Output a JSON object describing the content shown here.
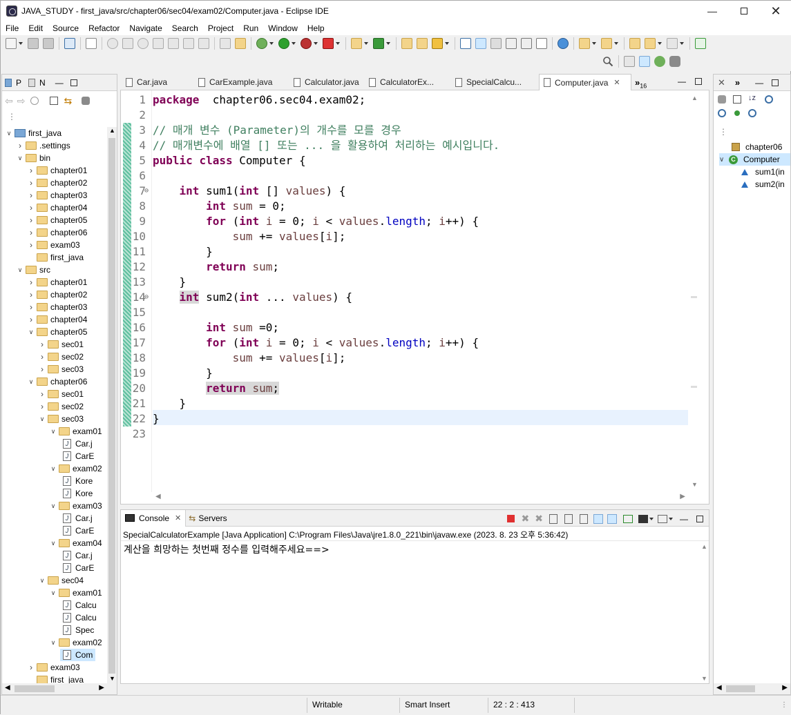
{
  "window": {
    "title": "JAVA_STUDY - first_java/src/chapter06/sec04/exam02/Computer.java - Eclipse IDE"
  },
  "menu": [
    "File",
    "Edit",
    "Source",
    "Refactor",
    "Navigate",
    "Search",
    "Project",
    "Run",
    "Window",
    "Help"
  ],
  "left_panel": {
    "tabs": [
      {
        "label": "P"
      },
      {
        "label": "N"
      }
    ],
    "tree": [
      {
        "label": "first_java",
        "depth": 0,
        "type": "project",
        "open": true
      },
      {
        "label": ".settings",
        "depth": 1,
        "type": "folder",
        "open": false
      },
      {
        "label": "bin",
        "depth": 1,
        "type": "folder",
        "open": true
      },
      {
        "label": "chapter01",
        "depth": 2,
        "type": "folder",
        "open": false
      },
      {
        "label": "chapter02",
        "depth": 2,
        "type": "folder",
        "open": false
      },
      {
        "label": "chapter03",
        "depth": 2,
        "type": "folder",
        "open": false
      },
      {
        "label": "chapter04",
        "depth": 2,
        "type": "folder",
        "open": false
      },
      {
        "label": "chapter05",
        "depth": 2,
        "type": "folder",
        "open": false
      },
      {
        "label": "chapter06",
        "depth": 2,
        "type": "folder",
        "open": false
      },
      {
        "label": "exam03",
        "depth": 2,
        "type": "folder",
        "open": false
      },
      {
        "label": "first_java",
        "depth": 2,
        "type": "folder",
        "leaf": true
      },
      {
        "label": "src",
        "depth": 1,
        "type": "folder",
        "open": true
      },
      {
        "label": "chapter01",
        "depth": 2,
        "type": "folder",
        "open": false
      },
      {
        "label": "chapter02",
        "depth": 2,
        "type": "folder",
        "open": false
      },
      {
        "label": "chapter03",
        "depth": 2,
        "type": "folder",
        "open": false
      },
      {
        "label": "chapter04",
        "depth": 2,
        "type": "folder",
        "open": false
      },
      {
        "label": "chapter05",
        "depth": 2,
        "type": "folder",
        "open": true
      },
      {
        "label": "sec01",
        "depth": 3,
        "type": "folder",
        "open": false
      },
      {
        "label": "sec02",
        "depth": 3,
        "type": "folder",
        "open": false
      },
      {
        "label": "sec03",
        "depth": 3,
        "type": "folder",
        "open": false
      },
      {
        "label": "chapter06",
        "depth": 2,
        "type": "folder",
        "open": true
      },
      {
        "label": "sec01",
        "depth": 3,
        "type": "folder",
        "open": false
      },
      {
        "label": "sec02",
        "depth": 3,
        "type": "folder",
        "open": false
      },
      {
        "label": "sec03",
        "depth": 3,
        "type": "folder",
        "open": true
      },
      {
        "label": "exam01",
        "depth": 4,
        "type": "folder",
        "open": true
      },
      {
        "label": "Car.j",
        "depth": 5,
        "type": "file"
      },
      {
        "label": "CarE",
        "depth": 5,
        "type": "file"
      },
      {
        "label": "exam02",
        "depth": 4,
        "type": "folder",
        "open": true
      },
      {
        "label": "Kore",
        "depth": 5,
        "type": "file"
      },
      {
        "label": "Kore",
        "depth": 5,
        "type": "file"
      },
      {
        "label": "exam03",
        "depth": 4,
        "type": "folder",
        "open": true
      },
      {
        "label": "Car.j",
        "depth": 5,
        "type": "file"
      },
      {
        "label": "CarE",
        "depth": 5,
        "type": "file"
      },
      {
        "label": "exam04",
        "depth": 4,
        "type": "folder",
        "open": true
      },
      {
        "label": "Car.j",
        "depth": 5,
        "type": "file"
      },
      {
        "label": "CarE",
        "depth": 5,
        "type": "file"
      },
      {
        "label": "sec04",
        "depth": 3,
        "type": "folder",
        "open": true
      },
      {
        "label": "exam01",
        "depth": 4,
        "type": "folder",
        "open": true
      },
      {
        "label": "Calcu",
        "depth": 5,
        "type": "file"
      },
      {
        "label": "Calcu",
        "depth": 5,
        "type": "file"
      },
      {
        "label": "Spec",
        "depth": 5,
        "type": "file"
      },
      {
        "label": "exam02",
        "depth": 4,
        "type": "folder",
        "open": true
      },
      {
        "label": "Com",
        "depth": 5,
        "type": "file",
        "selected": true
      },
      {
        "label": "exam03",
        "depth": 2,
        "type": "folder",
        "open": false
      },
      {
        "label": "first_java",
        "depth": 2,
        "type": "folder",
        "leaf": true
      }
    ]
  },
  "editor": {
    "tabs": [
      {
        "label": "Car.java",
        "active": false
      },
      {
        "label": "CarExample.java",
        "active": false
      },
      {
        "label": "Calculator.java",
        "active": false
      },
      {
        "label": "CalculatorEx...",
        "active": false
      },
      {
        "label": "SpecialCalcu...",
        "active": false
      },
      {
        "label": "Computer.java",
        "active": true
      }
    ],
    "overflow_count": "16",
    "lines": [
      {
        "n": "1",
        "fold": "",
        "html": [
          [
            "kw",
            "package"
          ],
          [
            "",
            "  chapter06.sec04.exam02;"
          ]
        ]
      },
      {
        "n": "2",
        "fold": "",
        "html": []
      },
      {
        "n": "3",
        "fold": "",
        "html": [
          [
            "cm",
            "// 매개 변수 (Parameter)의 개수를 모를 경우"
          ]
        ]
      },
      {
        "n": "4",
        "fold": "",
        "html": [
          [
            "cm",
            "// 매개변수에 배열 [] 또는 ... 을 활용하여 처리하는 예시입니다."
          ]
        ]
      },
      {
        "n": "5",
        "fold": "",
        "html": [
          [
            "kw",
            "public"
          ],
          [
            "",
            " "
          ],
          [
            "kw",
            "class"
          ],
          [
            "",
            " Computer {"
          ]
        ]
      },
      {
        "n": "6",
        "fold": "",
        "html": []
      },
      {
        "n": "7",
        "fold": "⊖",
        "html": [
          [
            "",
            "    "
          ],
          [
            "kw",
            "int"
          ],
          [
            "",
            " sum1("
          ],
          [
            "kw",
            "int"
          ],
          [
            "",
            " [] "
          ],
          [
            "var",
            "values"
          ],
          [
            "",
            ") {"
          ]
        ]
      },
      {
        "n": "8",
        "fold": "",
        "html": [
          [
            "",
            "        "
          ],
          [
            "kw",
            "int"
          ],
          [
            "",
            " "
          ],
          [
            "var",
            "sum"
          ],
          [
            "",
            " = 0;"
          ]
        ]
      },
      {
        "n": "9",
        "fold": "",
        "html": [
          [
            "",
            "        "
          ],
          [
            "kw",
            "for"
          ],
          [
            "",
            " ("
          ],
          [
            "kw",
            "int"
          ],
          [
            "",
            " "
          ],
          [
            "var",
            "i"
          ],
          [
            "",
            " = 0; "
          ],
          [
            "var",
            "i"
          ],
          [
            "",
            " < "
          ],
          [
            "var",
            "values"
          ],
          [
            "",
            "."
          ],
          [
            "fld",
            "length"
          ],
          [
            "",
            "; "
          ],
          [
            "var",
            "i"
          ],
          [
            "",
            "++) {"
          ]
        ]
      },
      {
        "n": "10",
        "fold": "",
        "html": [
          [
            "",
            "            "
          ],
          [
            "var",
            "sum"
          ],
          [
            "",
            " += "
          ],
          [
            "var",
            "values"
          ],
          [
            "",
            "["
          ],
          [
            "var",
            "i"
          ],
          [
            "",
            "];"
          ]
        ]
      },
      {
        "n": "11",
        "fold": "",
        "html": [
          [
            "",
            "        }"
          ]
        ]
      },
      {
        "n": "12",
        "fold": "",
        "html": [
          [
            "",
            "        "
          ],
          [
            "kw",
            "return"
          ],
          [
            "",
            " "
          ],
          [
            "var",
            "sum"
          ],
          [
            "",
            ";"
          ]
        ]
      },
      {
        "n": "13",
        "fold": "",
        "html": [
          [
            "",
            "    }"
          ]
        ]
      },
      {
        "n": "14",
        "fold": "⊖",
        "html": [
          [
            "",
            "    "
          ],
          [
            "kwhl",
            "int"
          ],
          [
            "",
            " sum2("
          ],
          [
            "kw",
            "int"
          ],
          [
            "",
            " ... "
          ],
          [
            "var",
            "values"
          ],
          [
            "",
            ") {"
          ]
        ]
      },
      {
        "n": "15",
        "fold": "",
        "html": []
      },
      {
        "n": "16",
        "fold": "",
        "html": [
          [
            "",
            "        "
          ],
          [
            "kw",
            "int"
          ],
          [
            "",
            " "
          ],
          [
            "var",
            "sum"
          ],
          [
            "",
            " =0;"
          ]
        ]
      },
      {
        "n": "17",
        "fold": "",
        "html": [
          [
            "",
            "        "
          ],
          [
            "kw",
            "for"
          ],
          [
            "",
            " ("
          ],
          [
            "kw",
            "int"
          ],
          [
            "",
            " "
          ],
          [
            "var",
            "i"
          ],
          [
            "",
            " = 0; "
          ],
          [
            "var",
            "i"
          ],
          [
            "",
            " < "
          ],
          [
            "var",
            "values"
          ],
          [
            "",
            "."
          ],
          [
            "fld",
            "length"
          ],
          [
            "",
            "; "
          ],
          [
            "var",
            "i"
          ],
          [
            "",
            "++) {"
          ]
        ]
      },
      {
        "n": "18",
        "fold": "",
        "html": [
          [
            "",
            "            "
          ],
          [
            "var",
            "sum"
          ],
          [
            "",
            " += "
          ],
          [
            "var",
            "values"
          ],
          [
            "",
            "["
          ],
          [
            "var",
            "i"
          ],
          [
            "",
            "];"
          ]
        ]
      },
      {
        "n": "19",
        "fold": "",
        "html": [
          [
            "",
            "        }"
          ]
        ]
      },
      {
        "n": "20",
        "fold": "",
        "html": [
          [
            "",
            "        "
          ],
          [
            "kwhl2",
            "return sum;"
          ]
        ]
      },
      {
        "n": "21",
        "fold": "",
        "html": [
          [
            "",
            "    }"
          ]
        ]
      },
      {
        "n": "22",
        "fold": "",
        "html": [
          [
            "",
            "}"
          ]
        ]
      },
      {
        "n": "23",
        "fold": "",
        "html": []
      }
    ]
  },
  "outline": {
    "items": [
      {
        "label": "chapter06",
        "depth": 0,
        "type": "package"
      },
      {
        "label": "Computer",
        "depth": 0,
        "type": "class",
        "selected": true
      },
      {
        "label": "sum1(in",
        "depth": 1,
        "type": "method"
      },
      {
        "label": "sum2(in",
        "depth": 1,
        "type": "method"
      }
    ]
  },
  "console": {
    "tabs": [
      {
        "label": "Console",
        "active": true
      },
      {
        "label": "Servers",
        "active": false
      }
    ],
    "launch_info": "SpecialCalculatorExample [Java Application] C:\\Program Files\\Java\\jre1.8.0_221\\bin\\javaw.exe  (2023. 8. 23 오후 5:36:42)",
    "output": "계산을 희망하는 첫번째 정수를 입력해주세요==>"
  },
  "status": {
    "writable": "Writable",
    "insert_mode": "Smart Insert",
    "position": "22 : 2 : 413"
  },
  "colors": {
    "keyword": "#7f0055",
    "comment": "#3f7f5f",
    "field": "#0000c0",
    "folder": "#f3d48a",
    "selection": "#cde8ff"
  }
}
